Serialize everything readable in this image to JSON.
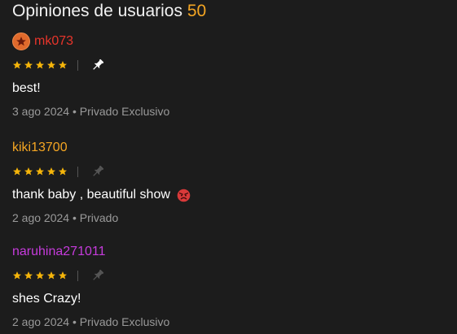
{
  "header": {
    "title": "Opiniones de usuarios",
    "count": "50"
  },
  "colors": {
    "background": "#1c1c1c",
    "count_accent": "#f5a623",
    "star": "#f5b50a",
    "meta_text": "#9a9a9a"
  },
  "reviews": [
    {
      "username": "mk073",
      "username_color": "#e8352b",
      "has_avatar": true,
      "avatar_icon": "star-badge-icon",
      "rating": 5,
      "pinned": true,
      "comment": "best!",
      "emoji": "",
      "date": "3 ago 2024",
      "separator": "•",
      "visibility": "Privado Exclusivo"
    },
    {
      "username": "kiki13700",
      "username_color": "#f5a623",
      "has_avatar": false,
      "rating": 5,
      "pinned": false,
      "comment": "thank baby , beautiful show",
      "emoji": "angry-face-icon",
      "date": "2 ago 2024",
      "separator": "•",
      "visibility": "Privado"
    },
    {
      "username": "naruhina271011",
      "username_color": "#c63bdc",
      "has_avatar": false,
      "rating": 5,
      "pinned": false,
      "comment": "shes Crazy!",
      "emoji": "",
      "date": "2 ago 2024",
      "separator": "•",
      "visibility": "Privado Exclusivo"
    }
  ]
}
